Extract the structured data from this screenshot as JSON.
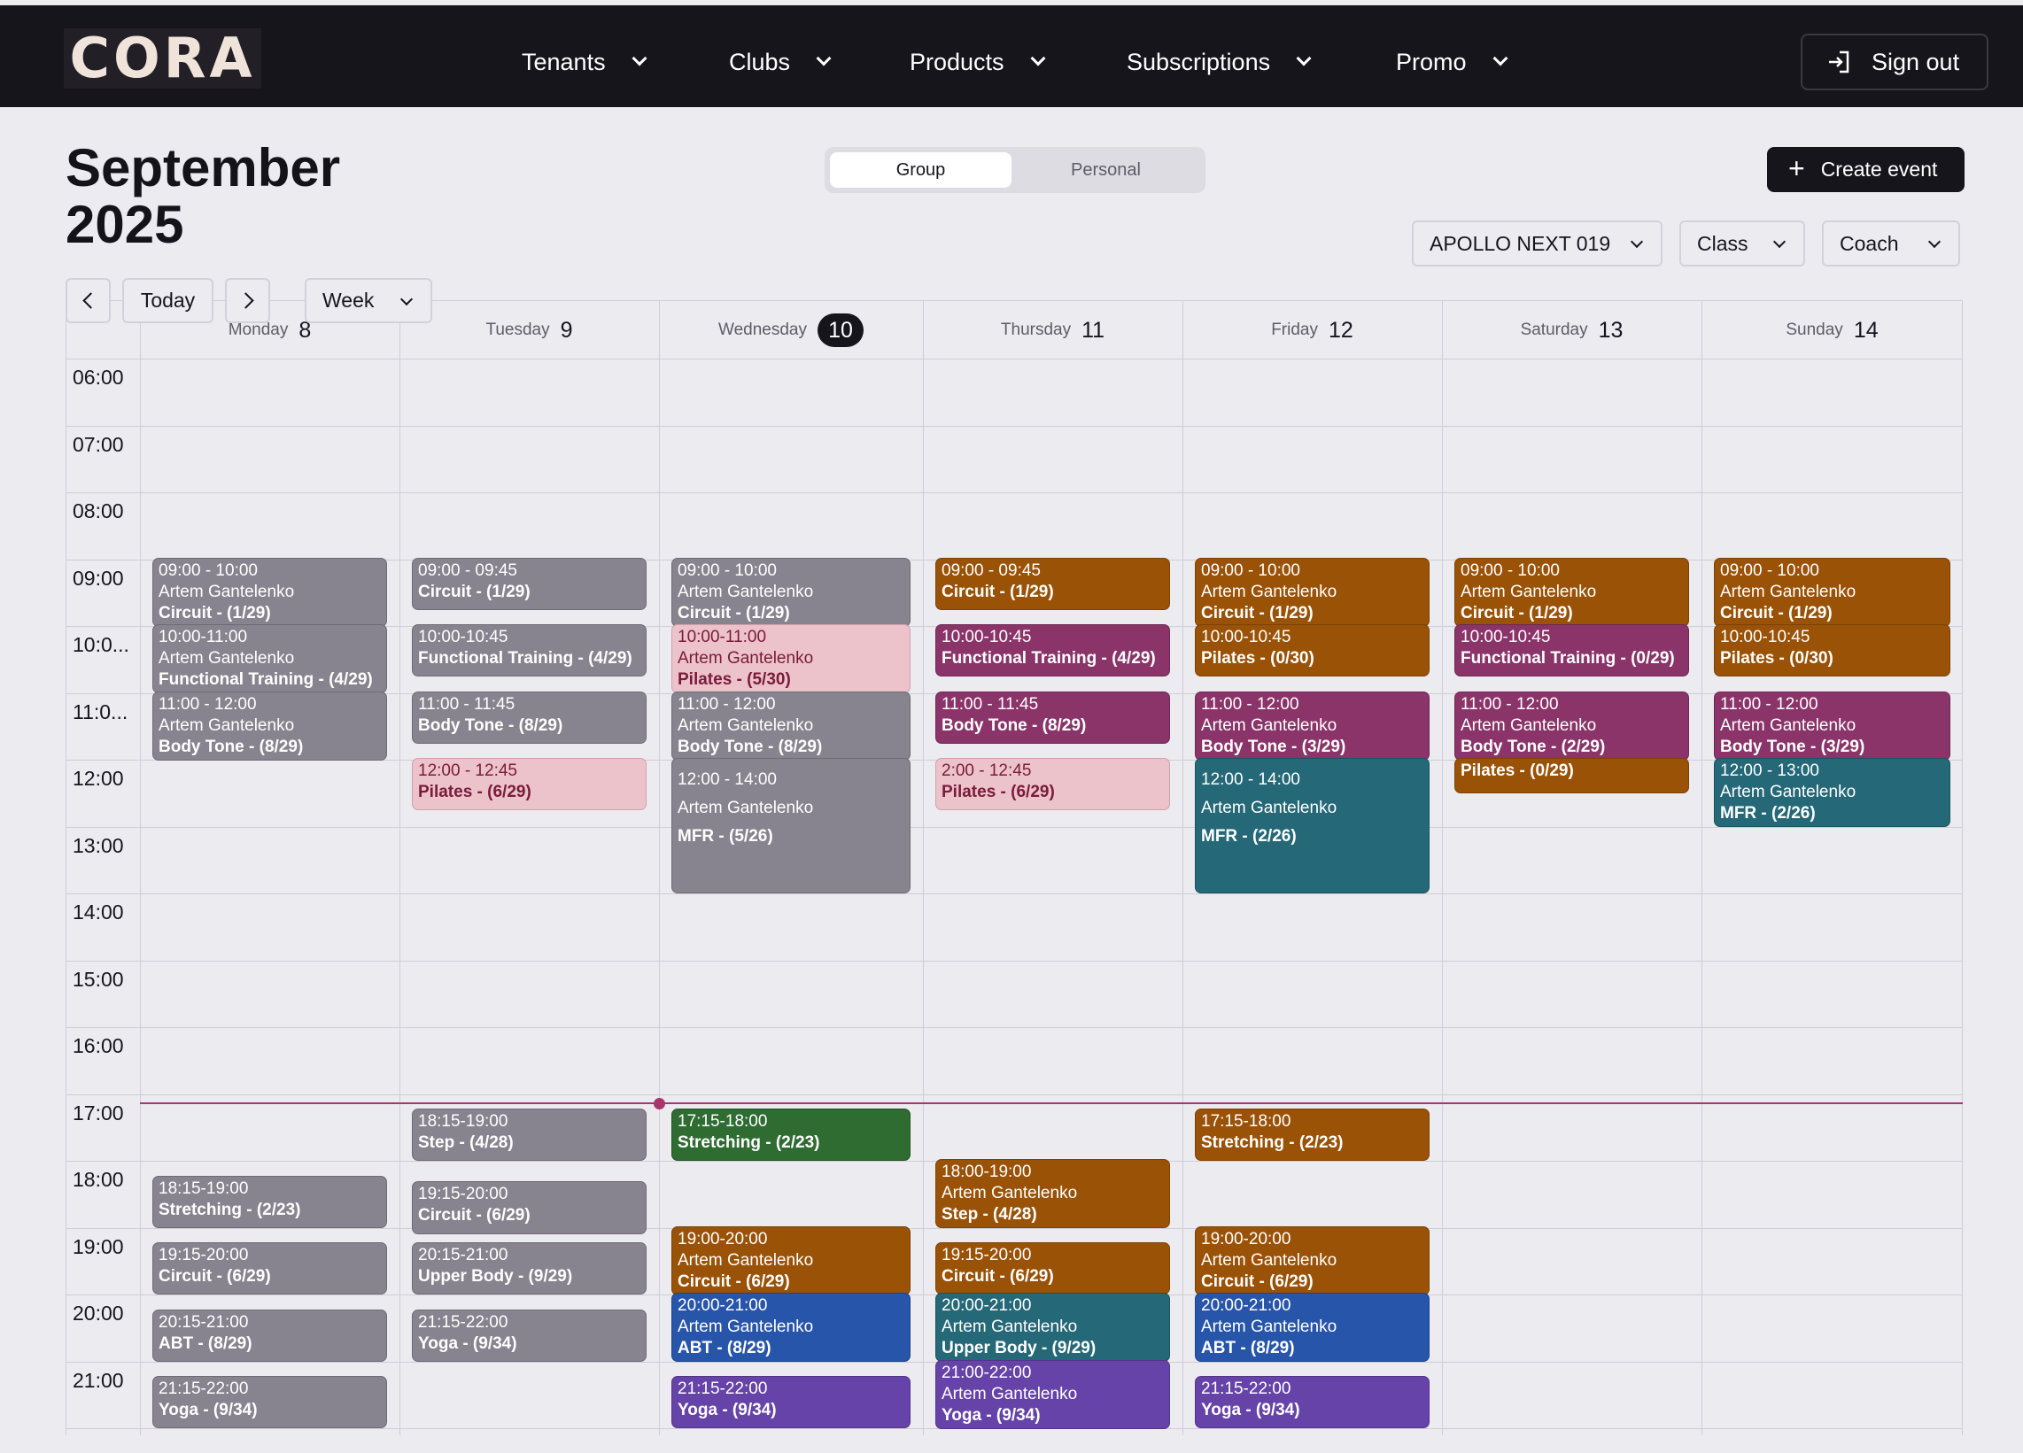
{
  "nav": {
    "logo": "CORA",
    "items": [
      "Tenants",
      "Clubs",
      "Products",
      "Subscriptions",
      "Promo"
    ],
    "sign_out": "Sign out"
  },
  "header": {
    "title": "September 2025",
    "toggle": {
      "group": "Group",
      "personal": "Personal",
      "selected": "Group"
    },
    "create_event": "Create event",
    "filters": {
      "club": "APOLLO NEXT 019",
      "class": "Class",
      "coach": "Coach"
    },
    "controls": {
      "today": "Today",
      "view": "Week"
    }
  },
  "days": [
    {
      "name": "Monday",
      "num": "8"
    },
    {
      "name": "Tuesday",
      "num": "9"
    },
    {
      "name": "Wednesday",
      "num": "10",
      "today": true
    },
    {
      "name": "Thursday",
      "num": "11"
    },
    {
      "name": "Friday",
      "num": "12"
    },
    {
      "name": "Saturday",
      "num": "13"
    },
    {
      "name": "Sunday",
      "num": "14"
    }
  ],
  "times": [
    "06:00",
    "07:00",
    "08:00",
    "09:00",
    "10:0...",
    "11:0...",
    "12:00",
    "13:00",
    "14:00",
    "15:00",
    "16:00",
    "17:00",
    "18:00",
    "19:00",
    "20:00",
    "21:00"
  ],
  "colors": {
    "gray": "#87848f",
    "brown": "#9a5206",
    "magenta": "#8a3469",
    "pink": "#ecc2cb",
    "teal": "#256877",
    "green": "#2f6c32",
    "blue": "#2755aa",
    "purple": "#6643a8",
    "now_line": "#a8366d"
  },
  "events": [
    {
      "day": 0,
      "start": 9.0,
      "end": 10.0,
      "color": "gray",
      "lines": [
        "09:00 - 10:00",
        "Artem Gantelenko",
        "Circuit - (1/29)"
      ]
    },
    {
      "day": 0,
      "start": 10.0,
      "end": 11.0,
      "color": "gray",
      "lines": [
        "10:00-11:00",
        "Artem Gantelenko",
        "Functional Training - (4/29)"
      ]
    },
    {
      "day": 0,
      "start": 11.0,
      "end": 12.0,
      "color": "gray",
      "lines": [
        "11:00 - 12:00",
        "Artem Gantelenko",
        "Body Tone - (8/29)"
      ]
    },
    {
      "day": 0,
      "start": 18.25,
      "end": 19.0,
      "color": "gray",
      "lines": [
        "18:15-19:00",
        "Stretching - (2/23)"
      ]
    },
    {
      "day": 0,
      "start": 19.25,
      "end": 20.0,
      "color": "gray",
      "lines": [
        "19:15-20:00",
        "Circuit - (6/29)"
      ]
    },
    {
      "day": 0,
      "start": 20.25,
      "end": 21.0,
      "color": "gray",
      "lines": [
        "20:15-21:00",
        "ABT - (8/29)"
      ]
    },
    {
      "day": 0,
      "start": 21.25,
      "end": 22.0,
      "color": "gray",
      "lines": [
        "21:15-22:00",
        "Yoga - (9/34)"
      ]
    },
    {
      "day": 1,
      "start": 9.0,
      "end": 9.75,
      "color": "gray",
      "lines": [
        "09:00 - 09:45",
        "Circuit - (1/29)"
      ]
    },
    {
      "day": 1,
      "start": 10.0,
      "end": 10.75,
      "color": "gray",
      "lines": [
        "10:00-10:45",
        "Functional Training - (4/29)"
      ]
    },
    {
      "day": 1,
      "start": 11.0,
      "end": 11.75,
      "color": "gray",
      "lines": [
        "11:00 - 11:45",
        "Body Tone - (8/29)"
      ]
    },
    {
      "day": 1,
      "start": 12.0,
      "end": 12.75,
      "color": "pink",
      "lines": [
        "12:00 - 12:45",
        "Pilates - (6/29)"
      ]
    },
    {
      "day": 1,
      "start": 17.25,
      "end": 18.0,
      "color": "gray",
      "lines": [
        "18:15-19:00",
        "Step - (4/28)"
      ]
    },
    {
      "day": 1,
      "start": 18.33,
      "end": 19.1,
      "color": "gray",
      "lines": [
        "19:15-20:00",
        "Circuit - (6/29)"
      ]
    },
    {
      "day": 1,
      "start": 19.25,
      "end": 20.0,
      "color": "gray",
      "lines": [
        "20:15-21:00",
        "Upper Body - (9/29)"
      ]
    },
    {
      "day": 1,
      "start": 20.25,
      "end": 21.0,
      "color": "gray",
      "lines": [
        "21:15-22:00",
        "Yoga - (9/34)"
      ]
    },
    {
      "day": 2,
      "start": 9.0,
      "end": 10.0,
      "color": "gray",
      "lines": [
        "09:00 - 10:00",
        "Artem Gantelenko",
        "Circuit - (1/29)"
      ]
    },
    {
      "day": 2,
      "start": 10.0,
      "end": 11.0,
      "color": "pink",
      "lines": [
        "10:00-11:00",
        "Artem Gantelenko",
        "Pilates - (5/30)"
      ]
    },
    {
      "day": 2,
      "start": 11.0,
      "end": 12.0,
      "color": "gray",
      "lines": [
        "11:00 - 12:00",
        "Artem Gantelenko",
        "Body Tone - (8/29)"
      ]
    },
    {
      "day": 2,
      "start": 12.0,
      "end": 14.0,
      "color": "gray",
      "big": true,
      "lines": [
        "12:00 - 14:00",
        "Artem Gantelenko",
        "MFR - (5/26)"
      ]
    },
    {
      "day": 2,
      "start": 17.25,
      "end": 18.0,
      "color": "green",
      "lines": [
        "17:15-18:00",
        "Stretching - (2/23)"
      ]
    },
    {
      "day": 2,
      "start": 19.0,
      "end": 20.0,
      "color": "brown",
      "lines": [
        "19:00-20:00",
        "Artem Gantelenko",
        "Circuit - (6/29)"
      ]
    },
    {
      "day": 2,
      "start": 20.0,
      "end": 21.0,
      "color": "blue",
      "lines": [
        "20:00-21:00",
        "Artem Gantelenko",
        "ABT - (8/29)"
      ]
    },
    {
      "day": 2,
      "start": 21.25,
      "end": 22.0,
      "color": "purple",
      "lines": [
        "21:15-22:00",
        "Yoga - (9/34)"
      ]
    },
    {
      "day": 3,
      "start": 9.0,
      "end": 9.75,
      "color": "brown",
      "lines": [
        "09:00 - 09:45",
        "Circuit - (1/29)"
      ]
    },
    {
      "day": 3,
      "start": 10.0,
      "end": 10.75,
      "color": "magenta",
      "lines": [
        "10:00-10:45",
        "Functional Training - (4/29)"
      ]
    },
    {
      "day": 3,
      "start": 11.0,
      "end": 11.75,
      "color": "magenta",
      "lines": [
        "11:00 - 11:45",
        "Body Tone - (8/29)"
      ]
    },
    {
      "day": 3,
      "start": 12.0,
      "end": 12.75,
      "color": "pink",
      "lines": [
        "2:00 - 12:45",
        "Pilates - (6/29)"
      ]
    },
    {
      "day": 3,
      "start": 18.0,
      "end": 19.0,
      "color": "brown",
      "lines": [
        "18:00-19:00",
        "Artem Gantelenko",
        "Step - (4/28)"
      ]
    },
    {
      "day": 3,
      "start": 19.25,
      "end": 20.0,
      "color": "brown",
      "lines": [
        "19:15-20:00",
        "Circuit - (6/29)"
      ]
    },
    {
      "day": 3,
      "start": 20.0,
      "end": 21.0,
      "color": "teal",
      "lines": [
        "20:00-21:00",
        "Artem Gantelenko",
        "Upper Body - (9/29)"
      ]
    },
    {
      "day": 3,
      "start": 21.0,
      "end": 22.0,
      "color": "purple",
      "lines": [
        "21:00-22:00",
        "Artem Gantelenko",
        "Yoga - (9/34)"
      ]
    },
    {
      "day": 4,
      "start": 9.0,
      "end": 10.0,
      "color": "brown",
      "lines": [
        "09:00 - 10:00",
        "Artem Gantelenko",
        "Circuit - (1/29)"
      ]
    },
    {
      "day": 4,
      "start": 10.0,
      "end": 10.75,
      "color": "brown",
      "lines": [
        "10:00-10:45",
        "Pilates - (0/30)"
      ]
    },
    {
      "day": 4,
      "start": 11.0,
      "end": 12.0,
      "color": "magenta",
      "lines": [
        "11:00 - 12:00",
        "Artem Gantelenko",
        "Body Tone - (3/29)"
      ]
    },
    {
      "day": 4,
      "start": 12.0,
      "end": 14.0,
      "color": "teal",
      "big": true,
      "lines": [
        "12:00 - 14:00",
        "Artem Gantelenko",
        "MFR - (2/26)"
      ]
    },
    {
      "day": 4,
      "start": 17.25,
      "end": 18.0,
      "color": "brown",
      "lines": [
        "17:15-18:00",
        "Stretching - (2/23)"
      ]
    },
    {
      "day": 4,
      "start": 19.0,
      "end": 20.0,
      "color": "brown",
      "lines": [
        "19:00-20:00",
        "Artem Gantelenko",
        "Circuit - (6/29)"
      ]
    },
    {
      "day": 4,
      "start": 20.0,
      "end": 21.0,
      "color": "blue",
      "lines": [
        "20:00-21:00",
        "Artem Gantelenko",
        "ABT - (8/29)"
      ]
    },
    {
      "day": 4,
      "start": 21.25,
      "end": 22.0,
      "color": "purple",
      "lines": [
        "21:15-22:00",
        "Yoga - (9/34)"
      ]
    },
    {
      "day": 5,
      "start": 9.0,
      "end": 10.0,
      "color": "brown",
      "lines": [
        "09:00 - 10:00",
        "Artem Gantelenko",
        "Circuit - (1/29)"
      ]
    },
    {
      "day": 5,
      "start": 10.0,
      "end": 10.75,
      "color": "magenta",
      "lines": [
        "10:00-10:45",
        "Functional Training - (0/29)"
      ]
    },
    {
      "day": 5,
      "start": 11.0,
      "end": 12.0,
      "color": "magenta",
      "lines": [
        "11:00 - 12:00",
        "Artem Gantelenko",
        "Body Tone - (2/29)"
      ]
    },
    {
      "day": 5,
      "start": 12.0,
      "end": 12.5,
      "color": "brown",
      "lines": [
        "Pilates - (0/29)"
      ]
    },
    {
      "day": 6,
      "start": 9.0,
      "end": 10.0,
      "color": "brown",
      "lines": [
        "09:00 - 10:00",
        "Artem Gantelenko",
        "Circuit - (1/29)"
      ]
    },
    {
      "day": 6,
      "start": 10.0,
      "end": 10.75,
      "color": "brown",
      "lines": [
        "10:00-10:45",
        "Pilates - (0/30)"
      ]
    },
    {
      "day": 6,
      "start": 11.0,
      "end": 12.0,
      "color": "magenta",
      "lines": [
        "11:00 - 12:00",
        "Artem Gantelenko",
        "Body Tone - (3/29)"
      ]
    },
    {
      "day": 6,
      "start": 12.0,
      "end": 13.0,
      "color": "teal",
      "lines": [
        "12:00 - 13:00",
        "Artem Gantelenko",
        "MFR - (2/26)"
      ]
    }
  ],
  "now_time": 17.12
}
